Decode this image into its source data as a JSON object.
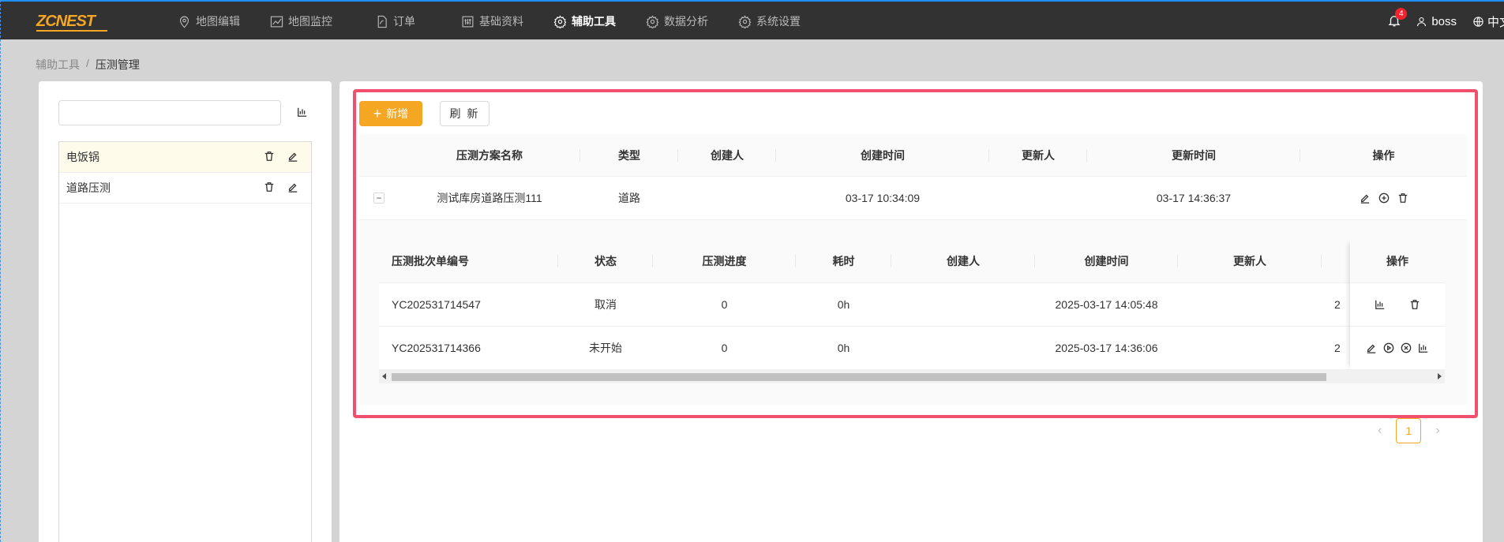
{
  "header": {
    "logo": "ZCNEST",
    "nav": [
      {
        "label": "地图编辑",
        "icon": "map-pin-icon"
      },
      {
        "label": "地图监控",
        "icon": "line-chart-icon"
      },
      {
        "label": "订单",
        "icon": "document-icon"
      },
      {
        "label": "基础资料",
        "icon": "sliders-icon"
      },
      {
        "label": "辅助工具",
        "icon": "gear-icon",
        "active": true
      },
      {
        "label": "数据分析",
        "icon": "gear-icon"
      },
      {
        "label": "系统设置",
        "icon": "gear-icon"
      }
    ],
    "notification_count": "4",
    "user": "boss",
    "language": "中文"
  },
  "breadcrumb": {
    "parent": "辅助工具",
    "separator": "/",
    "current": "压测管理"
  },
  "left": {
    "search_placeholder": "",
    "items": [
      {
        "label": "电饭锅",
        "selected": true
      },
      {
        "label": "道路压测",
        "selected": false
      }
    ]
  },
  "toolbar": {
    "add_label": "新增",
    "refresh_label": "刷 新"
  },
  "main_table": {
    "columns": [
      "压测方案名称",
      "类型",
      "创建人",
      "创建时间",
      "更新人",
      "更新时间",
      "操作"
    ],
    "rows": [
      {
        "expand": "−",
        "name": "测试库房道路压测111",
        "type": "道路",
        "creator": "",
        "created": "03-17 10:34:09",
        "updater": "",
        "updated": "03-17 14:36:37"
      }
    ]
  },
  "sub_table": {
    "columns": [
      "压测批次单编号",
      "状态",
      "压测进度",
      "耗时",
      "创建人",
      "创建时间",
      "更新人",
      "",
      "操作"
    ],
    "rows": [
      {
        "id": "YC202531714547",
        "status": "取消",
        "progress": "0",
        "duration": "0h",
        "creator": "",
        "created": "2025-03-17 14:05:48",
        "updater": "",
        "extra": "2"
      },
      {
        "id": "YC202531714366",
        "status": "未开始",
        "progress": "0",
        "duration": "0h",
        "creator": "",
        "created": "2025-03-17 14:36:06",
        "updater": "",
        "extra": "2"
      }
    ]
  },
  "pagination": {
    "prev": "‹",
    "current": "1",
    "next": "›"
  },
  "colors": {
    "accent": "#f5a623",
    "highlight": "#f0506e",
    "topbar": "#323232"
  }
}
